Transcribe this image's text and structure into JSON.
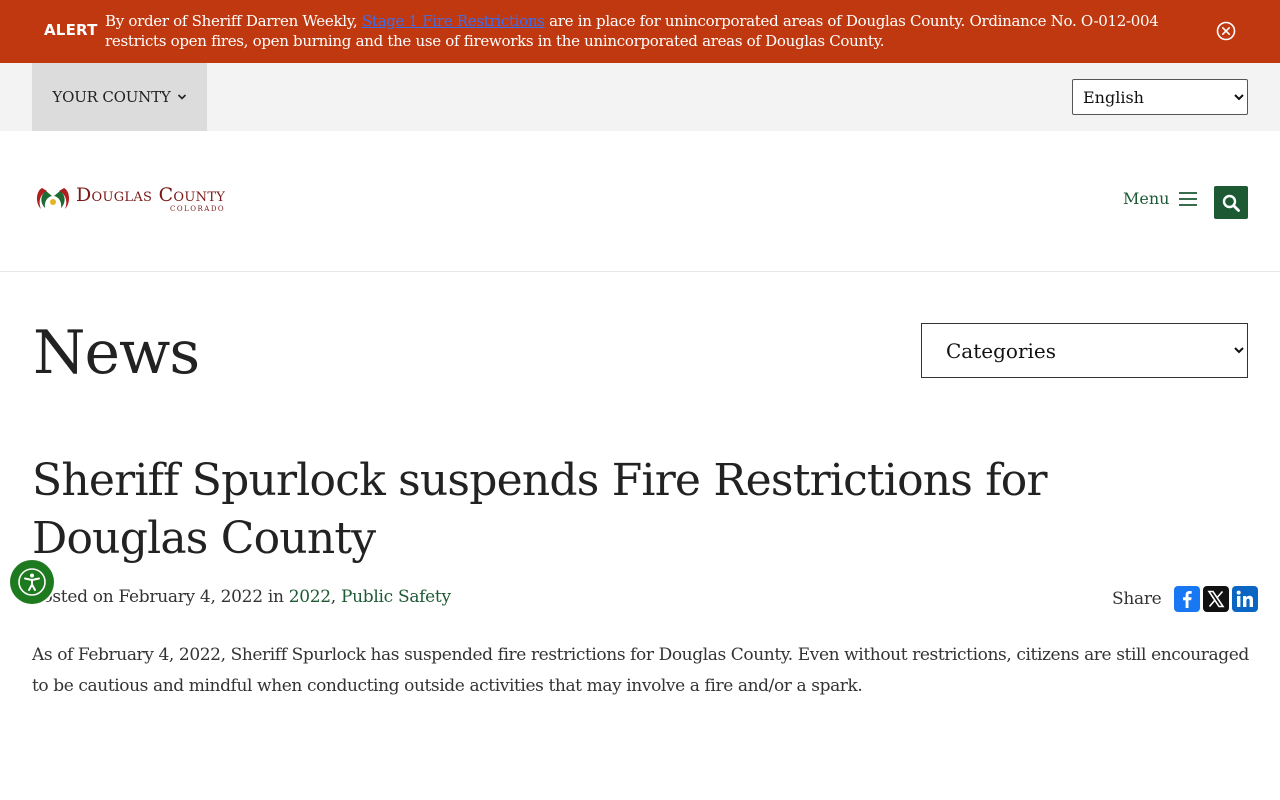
{
  "alert": {
    "label": "ALERT",
    "text_before": "By order of Sheriff Darren Weekly, ",
    "link_text": "Stage 1 Fire Restrictions",
    "text_after": " are in place for unincorporated areas of Douglas County. Ordinance No. O-012-004 restricts open fires, open burning and the use of fireworks in the unincorporated areas of Douglas County.",
    "close_icon": "close-circle-icon",
    "background": "#c0380f"
  },
  "utility": {
    "county_label": "YOUR COUNTY",
    "language_selected": "English",
    "language_options": [
      "English"
    ]
  },
  "header": {
    "logo_name": "Douglas County",
    "logo_sub": "COLORADO",
    "menu_label": "Menu",
    "menu_icon": "hamburger-icon",
    "search_icon": "search-icon",
    "accent": "#1d5a34"
  },
  "main": {
    "page_title": "News",
    "categories_selected": "Categories",
    "article_title": "Sheriff Spurlock suspends Fire Restrictions for Douglas County",
    "meta_prefix": "Posted on February 4, 2022 in ",
    "meta_categories": [
      "2022",
      "Public Safety"
    ],
    "share_label": "Share",
    "share_icons": [
      "facebook-icon",
      "x-icon",
      "linkedin-icon"
    ],
    "body": "As of February 4, 2022, Sheriff Spurlock has suspended fire restrictions for Douglas County.  Even without restrictions, citizens are still encouraged to be cautious and mindful when conducting outside activities that may involve a fire and/or a spark."
  },
  "accessibility": {
    "icon": "accessibility-icon",
    "color": "#1e7a1e"
  }
}
